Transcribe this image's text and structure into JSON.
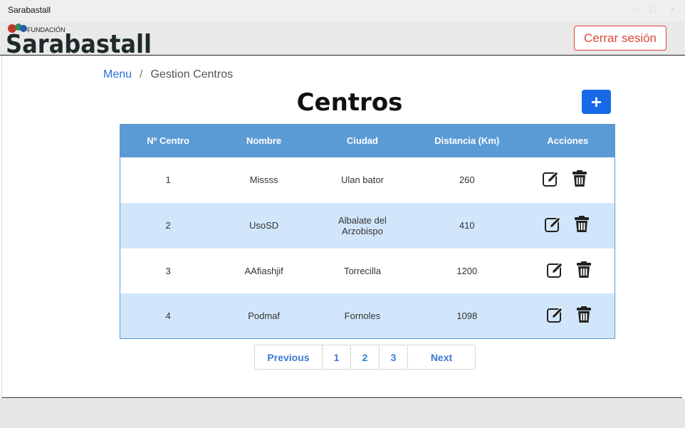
{
  "window": {
    "title": "Sarabastall"
  },
  "header": {
    "logo_small": "FUNDACIÓN",
    "logo_main": "Sarabastall",
    "logout_label": "Cerrar sesión"
  },
  "breadcrumb": {
    "items": [
      "Menu",
      "Gestion Centros"
    ]
  },
  "page": {
    "title": "Centros",
    "add_label": "+"
  },
  "table": {
    "headers": [
      "Nº Centro",
      "Nombre",
      "Ciudad",
      "Distancia (Km)",
      "Acciones"
    ],
    "rows": [
      {
        "num": "1",
        "nombre": "Missss",
        "ciudad": "Ulan bator",
        "distancia": "260"
      },
      {
        "num": "2",
        "nombre": "UsoSD",
        "ciudad": "Albalate del Arzobispo",
        "distancia": "410"
      },
      {
        "num": "3",
        "nombre": "AAfiashjif",
        "ciudad": "Torrecilla",
        "distancia": "1200"
      },
      {
        "num": "4",
        "nombre": "Podmaf",
        "ciudad": "Fornoles",
        "distancia": "1098"
      }
    ],
    "action_icons": [
      "edit-icon",
      "trash-icon"
    ]
  },
  "pagination": {
    "previous": "Previous",
    "pages": [
      "1",
      "2",
      "3"
    ],
    "next": "Next"
  },
  "colors": {
    "accent": "#1769e8",
    "table_header": "#5b9bd5",
    "row_alt": "#d2e6fb",
    "logout": "#e0453b"
  }
}
